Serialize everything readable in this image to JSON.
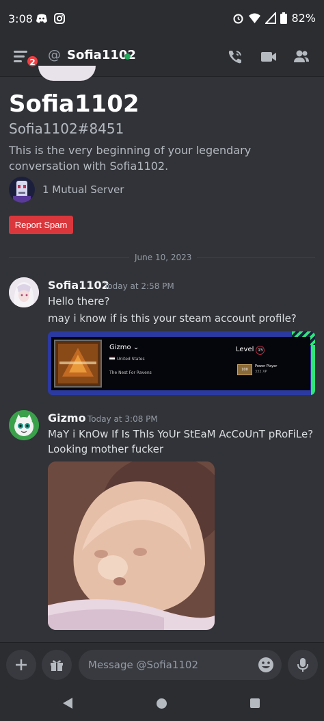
{
  "status_bar": {
    "time": "3:08",
    "battery": "82%",
    "icons": [
      "discord-icon",
      "instagram-icon",
      "alarm-icon",
      "wifi-icon",
      "cell-signal-icon",
      "battery-icon"
    ]
  },
  "header": {
    "unread_badge": "2",
    "username": "Sofia1102",
    "status_color": "#23a55a",
    "icons": [
      "call-icon",
      "video-icon",
      "members-icon"
    ]
  },
  "intro": {
    "display_name": "Sofia1102",
    "tag": "Sofia1102#8451",
    "description": "This is the very beginning of your legendary conversation with Sofia1102.",
    "mutual_servers": "1 Mutual Server",
    "report_button": "Report Spam"
  },
  "divider_date": "June 10, 2023",
  "messages": [
    {
      "author": "Sofia1102",
      "timestamp": "Today at 2:58 PM",
      "lines": [
        "Hello there?",
        "may i know if is this your steam account profile?"
      ],
      "embed": {
        "profile_name": "Gizmo",
        "country": "United States",
        "summary": "The Nest For Ravens",
        "level_label": "Level",
        "level": "15",
        "badge_label": "100",
        "badge_name": "Power Player",
        "badge_xp": "332 XP"
      }
    },
    {
      "author": "Gizmo",
      "timestamp": "Today at 3:08 PM",
      "lines": [
        "MaY i KnOw If Is ThIs YoUr StEaM AcCoUnT pRoFiLe?",
        "Looking mother fucker"
      ]
    }
  ],
  "composer": {
    "placeholder": "Message @Sofia1102"
  },
  "colors": {
    "accent_red": "#da373c",
    "online_green": "#23a55a",
    "background": "#313338"
  }
}
